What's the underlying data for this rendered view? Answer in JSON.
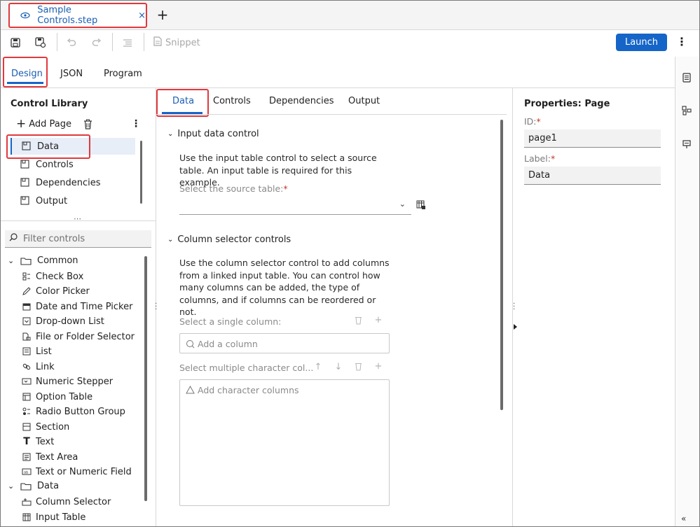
{
  "window": {
    "file_tab": "Sample Controls.step",
    "file_tab_close": "×",
    "new_tab": "+"
  },
  "toolbar": {
    "snippet_label": "Snippet",
    "launch_label": "Launch",
    "more": "⋮"
  },
  "mode_tabs": [
    {
      "label": "Design",
      "active": true
    },
    {
      "label": "JSON",
      "active": false
    },
    {
      "label": "Program",
      "active": false
    }
  ],
  "control_library": {
    "title": "Control Library",
    "add_page_label": "Add Page",
    "more": "⋮",
    "pages": [
      {
        "label": "Data",
        "selected": true
      },
      {
        "label": "Controls",
        "selected": false
      },
      {
        "label": "Dependencies",
        "selected": false
      },
      {
        "label": "Output",
        "selected": false
      }
    ],
    "splitter": "⋯",
    "filter_placeholder": "Filter controls",
    "groups": [
      {
        "label": "Common",
        "expanded": true,
        "items": [
          {
            "label": "Check Box",
            "icon": "checkbox-icon"
          },
          {
            "label": "Color Picker",
            "icon": "color-picker-icon"
          },
          {
            "label": "Date and Time Picker",
            "icon": "calendar-icon"
          },
          {
            "label": "Drop-down List",
            "icon": "dropdown-icon"
          },
          {
            "label": "File or Folder Selector",
            "icon": "file-folder-icon"
          },
          {
            "label": "List",
            "icon": "list-icon"
          },
          {
            "label": "Link",
            "icon": "link-icon"
          },
          {
            "label": "Numeric Stepper",
            "icon": "stepper-icon"
          },
          {
            "label": "Option Table",
            "icon": "option-table-icon"
          },
          {
            "label": "Radio Button Group",
            "icon": "radio-icon"
          },
          {
            "label": "Section",
            "icon": "section-icon"
          },
          {
            "label": "Text",
            "icon": "text-icon"
          },
          {
            "label": "Text Area",
            "icon": "text-area-icon"
          },
          {
            "label": "Text or Numeric Field",
            "icon": "text-field-icon"
          }
        ]
      },
      {
        "label": "Data",
        "expanded": true,
        "items": [
          {
            "label": "Column Selector",
            "icon": "column-selector-icon"
          },
          {
            "label": "Input Table",
            "icon": "input-table-icon"
          }
        ]
      }
    ]
  },
  "page_tabs": [
    {
      "label": "Data",
      "active": true
    },
    {
      "label": "Controls",
      "active": false
    },
    {
      "label": "Dependencies",
      "active": false
    },
    {
      "label": "Output",
      "active": false
    }
  ],
  "sections": {
    "input_data": {
      "title": "Input data control",
      "description": "Use the input table control to select a source table. An input table is required for this example.",
      "source_label": "Select the source table:",
      "required_mark": "*",
      "source_value": ""
    },
    "column_selector": {
      "title": "Column selector controls",
      "description": "Use the column selector control to add columns from a linked input table. You can control how many columns can be added, the type of columns, and if columns can be reordered or not.",
      "single_label": "Select a single column:",
      "single_placeholder": "Add a column",
      "multi_label": "Select multiple character col...",
      "multi_placeholder": "Add character columns"
    }
  },
  "properties": {
    "title": "Properties: Page",
    "id_label": "ID:",
    "id_value": "page1",
    "label_label": "Label:",
    "label_value": "Data",
    "required_mark": "*"
  },
  "right_strip": {
    "collapse": "«"
  },
  "colors": {
    "accent": "#1565c8",
    "highlight_box": "#e0393e",
    "selected_bg": "#e8eef8"
  }
}
